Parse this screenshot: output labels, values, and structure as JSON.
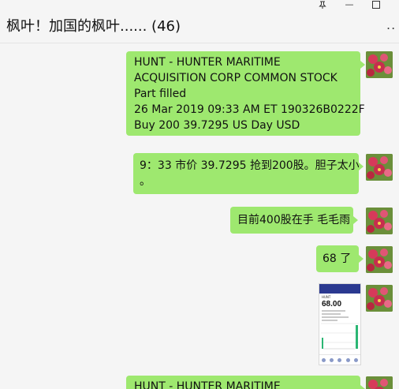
{
  "window": {
    "title": "枫叶！加国的枫叶...... (46)",
    "pin_icon": "pin-icon",
    "min_glyph": "—",
    "more_glyph": ".."
  },
  "messages": [
    {
      "type": "text",
      "lines": [
        "HUNT - HUNTER MARITIME",
        "ACQUISITION CORP COMMON STOCK",
        "Part filled",
        "26 Mar 2019 09:33 AM ET 190326B0222F",
        "Buy 200 39.7295 US Day USD"
      ]
    },
    {
      "type": "text",
      "lines": [
        "9：33 市价 39.7295 抢到200股。胆子太小",
        "。"
      ]
    },
    {
      "type": "text",
      "lines": [
        "目前400股在手 毛毛雨"
      ]
    },
    {
      "type": "text",
      "lines": [
        "68 了"
      ]
    },
    {
      "type": "image",
      "thumb": {
        "ticker": "HUNT",
        "price": "68.00"
      }
    },
    {
      "type": "text",
      "lines": [
        "HUNT - HUNTER MARITIME"
      ]
    }
  ],
  "colors": {
    "bubble": "#9ee86f",
    "background": "#f5f5f5",
    "thumb_header": "#2b3990",
    "thumb_chart": "#2bb673"
  }
}
